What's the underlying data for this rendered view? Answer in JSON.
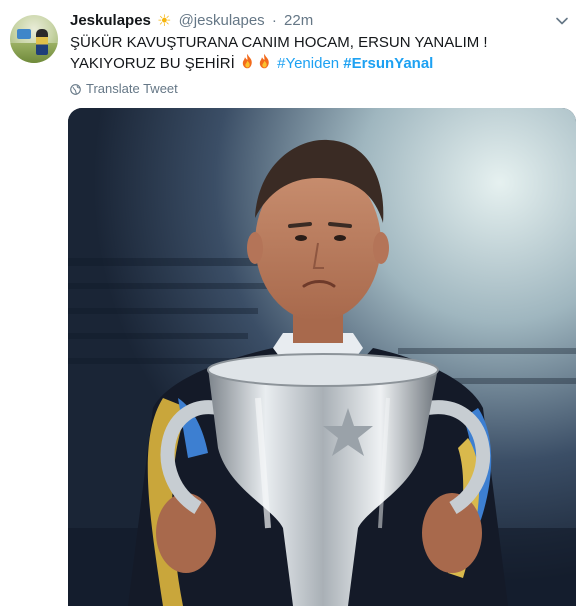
{
  "tweet": {
    "display_name": "Jeskulapes",
    "name_emoji": "☀",
    "handle": "@jeskulapes",
    "separator": "·",
    "time": "22m",
    "text_part1": "ŞÜKÜR KAVUŞTURANA CANIM HOCAM, ERSUN YANALIM ! YAKIYORUZ BU ŞEHİRİ",
    "emojis": [
      "fire-icon",
      "fire-icon"
    ],
    "hashtag1": "#Yeniden",
    "hashtag2": "#ErsunYanal",
    "translate_label": "Translate Tweet"
  },
  "icons": {
    "avatar": "avatar-image",
    "more": "chevron-down-icon",
    "translate": "globe-icon"
  },
  "colors": {
    "link": "#1da1f2",
    "muted": "#657786",
    "text": "#14171a"
  }
}
